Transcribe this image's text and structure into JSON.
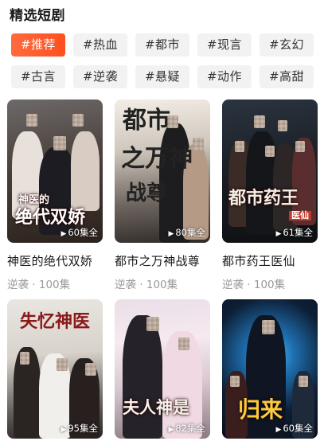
{
  "header": {
    "title": "精选短剧"
  },
  "tags": [
    {
      "label": "#推荐",
      "active": true
    },
    {
      "label": "#热血",
      "active": false
    },
    {
      "label": "#都市",
      "active": false
    },
    {
      "label": "#现言",
      "active": false
    },
    {
      "label": "#玄幻",
      "active": false
    },
    {
      "label": "#古言",
      "active": false
    },
    {
      "label": "#逆袭",
      "active": false
    },
    {
      "label": "#悬疑",
      "active": false
    },
    {
      "label": "#动作",
      "active": false
    },
    {
      "label": "#高甜",
      "active": false
    }
  ],
  "dramas": [
    {
      "title": "神医的绝代双娇",
      "meta": "逆袭 · 100集",
      "episodes": "60集全",
      "poster_text": [
        "神医的",
        "绝代双娇"
      ]
    },
    {
      "title": "都市之万神战尊",
      "meta": "逆袭 · 100集",
      "episodes": "80集全",
      "poster_text": [
        "都市",
        "之万神",
        "战尊"
      ]
    },
    {
      "title": "都市药王医仙",
      "meta": "逆袭 · 100集",
      "episodes": "61集全",
      "poster_text": [
        "都市药王",
        "医仙"
      ]
    },
    {
      "title": "",
      "meta": "",
      "episodes": "95集全",
      "poster_text": [
        "失忆神医"
      ]
    },
    {
      "title": "",
      "meta": "",
      "episodes": "82集全",
      "poster_text": [
        "夫人神是"
      ]
    },
    {
      "title": "",
      "meta": "",
      "episodes": "60集全",
      "poster_text": [
        "归来"
      ]
    }
  ]
}
